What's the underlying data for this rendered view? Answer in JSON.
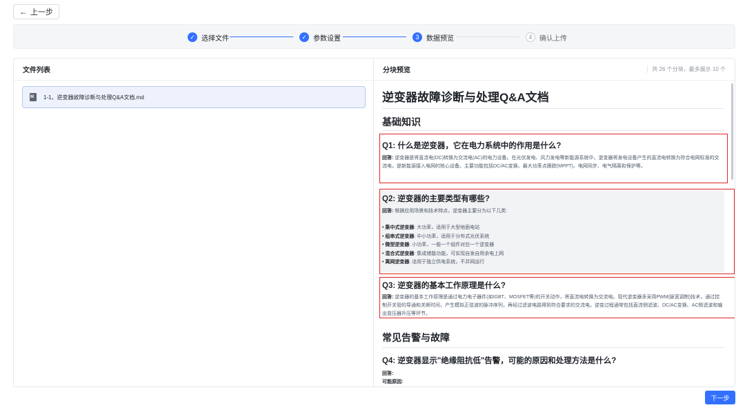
{
  "back_button": {
    "label": "上一步",
    "icon": "arrow-left-icon"
  },
  "steps": [
    {
      "number": "1",
      "label": "选择文件",
      "status": "done"
    },
    {
      "number": "2",
      "label": "参数设置",
      "status": "done"
    },
    {
      "number": "3",
      "label": "数据预览",
      "status": "active"
    },
    {
      "number": "4",
      "label": "确认上传",
      "status": "pending"
    }
  ],
  "colors": {
    "accent": "#3370ff",
    "chunk_border": "#e02424"
  },
  "file_panel": {
    "title": "文件列表",
    "files": [
      {
        "name": "1-1、逆变器故障诊断与处理Q&A文档.md",
        "icon": "markdown-file-icon"
      }
    ]
  },
  "preview_panel": {
    "title": "分块预览",
    "count_text": "共 26 个分块，最多展示 10 个",
    "doc": {
      "title": "逆变器故障诊断与处理Q&A文档",
      "section1": "基础知识",
      "q1": {
        "heading": "Q1: 什么是逆变器，它在电力系统中的作用是什么?",
        "answer_label": "回答:",
        "answer": " 逆变器是将直流电(DC)转换为交流电(AC)的电力设备。在光伏发电、风力发电等新能源系统中，逆变器将发电设备产生的直流电转换为符合电网标准的交流电，是新能源接入电网的核心设备。主要功能包括DC/AC变换、最大功率点跟踪(MPPT)、电网同步、电气隔离和保护等。"
      },
      "q2": {
        "heading": "Q2: 逆变器的主要类型有哪些?",
        "answer_label": "回答:",
        "answer": " 根据应用场景和技术特点，逆变器主要分为以下几类:",
        "items": [
          {
            "name": "集中式逆变器",
            "desc": ": 大功率，适用于大型地面电站"
          },
          {
            "name": "组串式逆变器",
            "desc": ": 中小功率，适用于分布式光伏系统"
          },
          {
            "name": "微型逆变器",
            "desc": ": 小功率，一般一个组件对应一个逆变器"
          },
          {
            "name": "混合式逆变器",
            "desc": ": 集成储能功能，可实现自发自用余电上网"
          },
          {
            "name": "离网逆变器",
            "desc": ": 适用于独立供电系统，不并网运行"
          }
        ]
      },
      "q3": {
        "heading": "Q3: 逆变器的基本工作原理是什么?",
        "answer_label": "回答:",
        "answer": " 逆变器的基本工作原理是通过电力电子器件(如IGBT、MOSFET等)的开关动作，将直流电转换为交流电。现代逆变器多采用PWM(脉宽调制)技术，通过控制开关管的导通和关断时间，产生模拟正弦波的脉冲序列，再经过滤波电路得到符合要求的交流电。逆变过程通常包括直流侧滤波、DC/AC变换、AC侧滤波和输出变压器升压等环节。"
      },
      "section2": "常见告警与故障",
      "q4": {
        "heading": "Q4: 逆变器显示\"绝缘阻抗低\"告警，可能的原因和处理方法是什么?",
        "answer_label": "回答:",
        "causes_label": "可能原因:"
      }
    }
  },
  "next_button": {
    "label": "下一步"
  }
}
